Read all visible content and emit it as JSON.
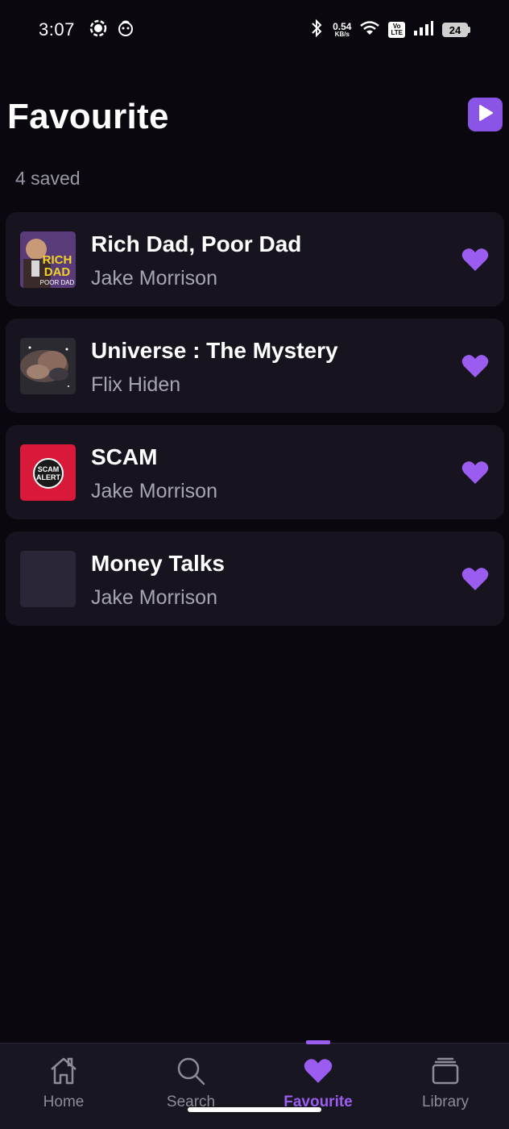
{
  "status_bar": {
    "time": "3:07",
    "net_speed_value": "0.54",
    "net_speed_unit": "KB/s",
    "volte_top": "Vo",
    "volte_bottom": "LTE",
    "battery": "24"
  },
  "header": {
    "title": "Favourite",
    "saved_count": "4 saved"
  },
  "favourites": [
    {
      "title": "Rich Dad, Poor Dad",
      "author": "Jake Morrison",
      "cover_text": [
        "RICH",
        "DAD",
        "POOR DAD"
      ]
    },
    {
      "title": "Universe : The Mystery",
      "author": "Flix Hiden"
    },
    {
      "title": "SCAM",
      "author": "Jake Morrison",
      "cover_text": [
        "SCAM",
        "ALERT"
      ]
    },
    {
      "title": "Money Talks",
      "author": "Jake Morrison"
    }
  ],
  "nav": {
    "items": [
      {
        "label": "Home"
      },
      {
        "label": "Search"
      },
      {
        "label": "Favourite"
      },
      {
        "label": "Library"
      }
    ],
    "active_index": 2
  },
  "colors": {
    "accent": "#8a55e6",
    "accent_light": "#9b5cf0",
    "background": "#0a080e",
    "card": "#17141f"
  }
}
